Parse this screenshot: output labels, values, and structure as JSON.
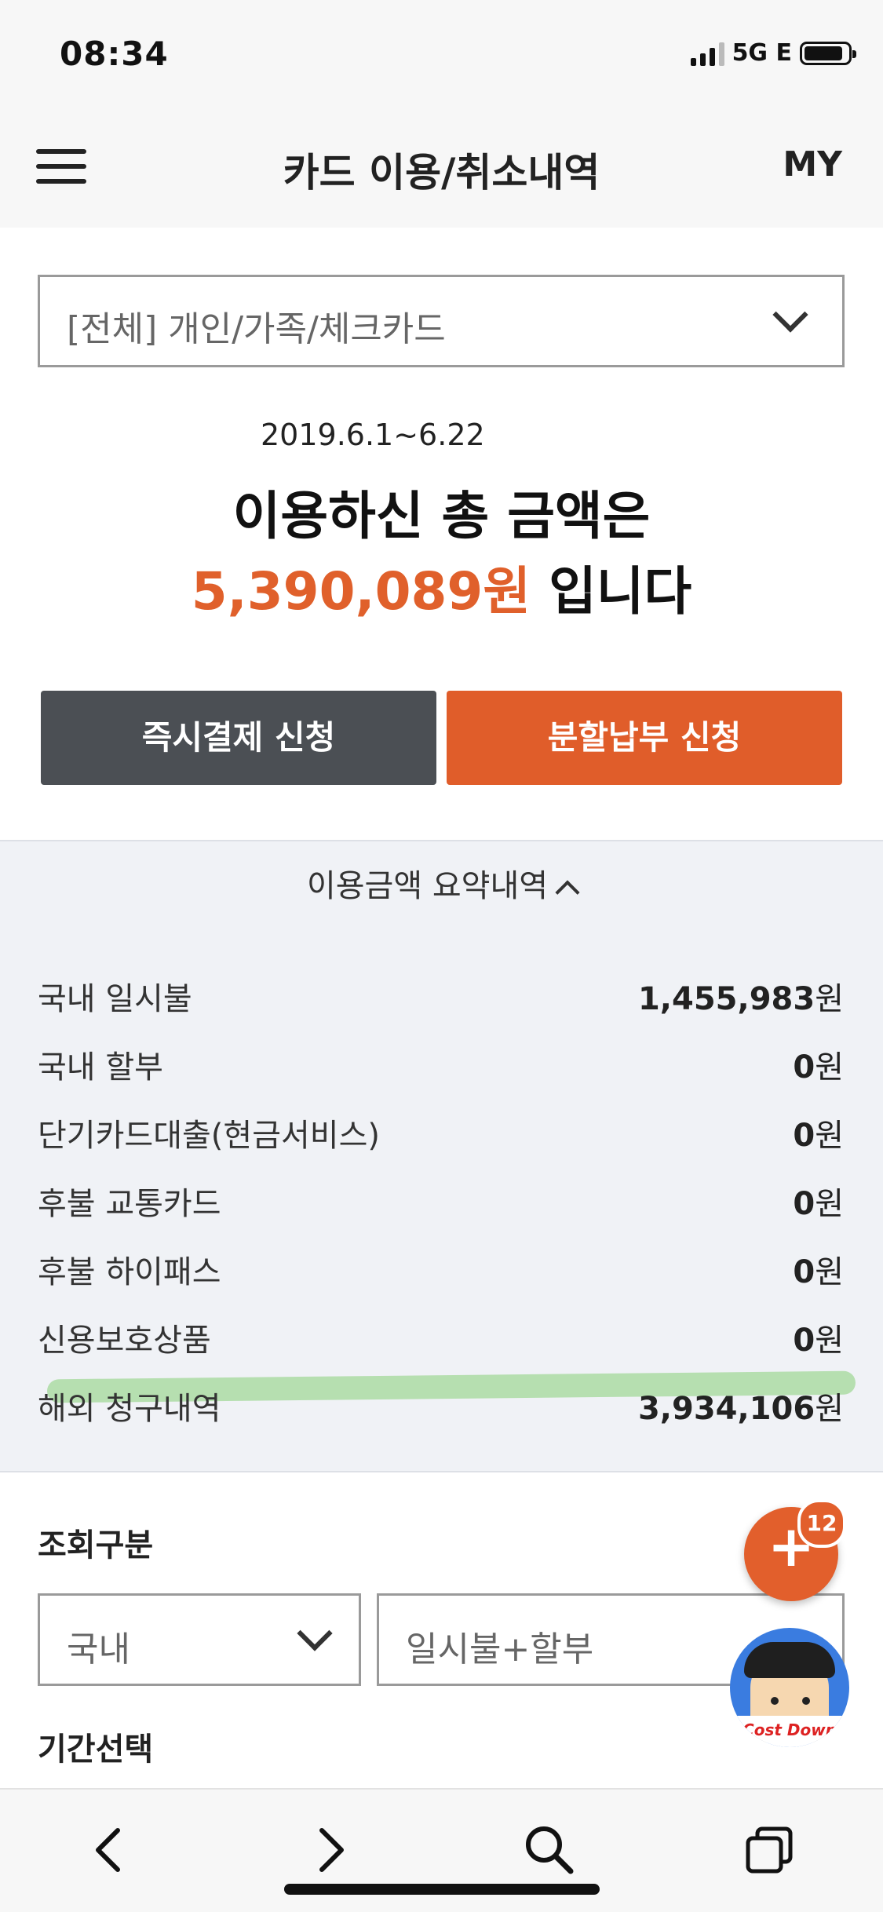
{
  "status_bar": {
    "time": "08:34",
    "network": "5G E"
  },
  "header": {
    "title": "카드 이용/취소내역",
    "my_label": "MY"
  },
  "card_select": {
    "value": "[전체] 개인/가족/체크카드"
  },
  "summary_top": {
    "period": "2019.6.1~6.22",
    "line1": "이용하신 총 금액은",
    "amount": "5,390,089원",
    "suffix": "입니다"
  },
  "buttons": {
    "instant_pay": "즉시결제 신청",
    "installment": "분할납부 신청"
  },
  "summary": {
    "toggle_label": "이용금액 요약내역",
    "rows": [
      {
        "label": "국내 일시불",
        "amount": "1,455,983",
        "unit": "원"
      },
      {
        "label": "국내 할부",
        "amount": "0",
        "unit": "원"
      },
      {
        "label": "단기카드대출(현금서비스)",
        "amount": "0",
        "unit": "원"
      },
      {
        "label": "후불 교통카드",
        "amount": "0",
        "unit": "원"
      },
      {
        "label": "후불 하이패스",
        "amount": "0",
        "unit": "원"
      },
      {
        "label": "신용보호상품",
        "amount": "0",
        "unit": "원"
      },
      {
        "label": "해외 청구내역",
        "amount": "3,934,106",
        "unit": "원"
      }
    ]
  },
  "filters": {
    "section_label": "조회구분",
    "region_value": "국내",
    "type_value": "일시불+할부",
    "period_label": "기간선택"
  },
  "fab": {
    "badge_count": "12"
  },
  "mascot": {
    "label": "Cost Down"
  },
  "toolbar": {
    "icons": [
      "back-icon",
      "forward-icon",
      "search-icon",
      "tabs-icon"
    ]
  }
}
